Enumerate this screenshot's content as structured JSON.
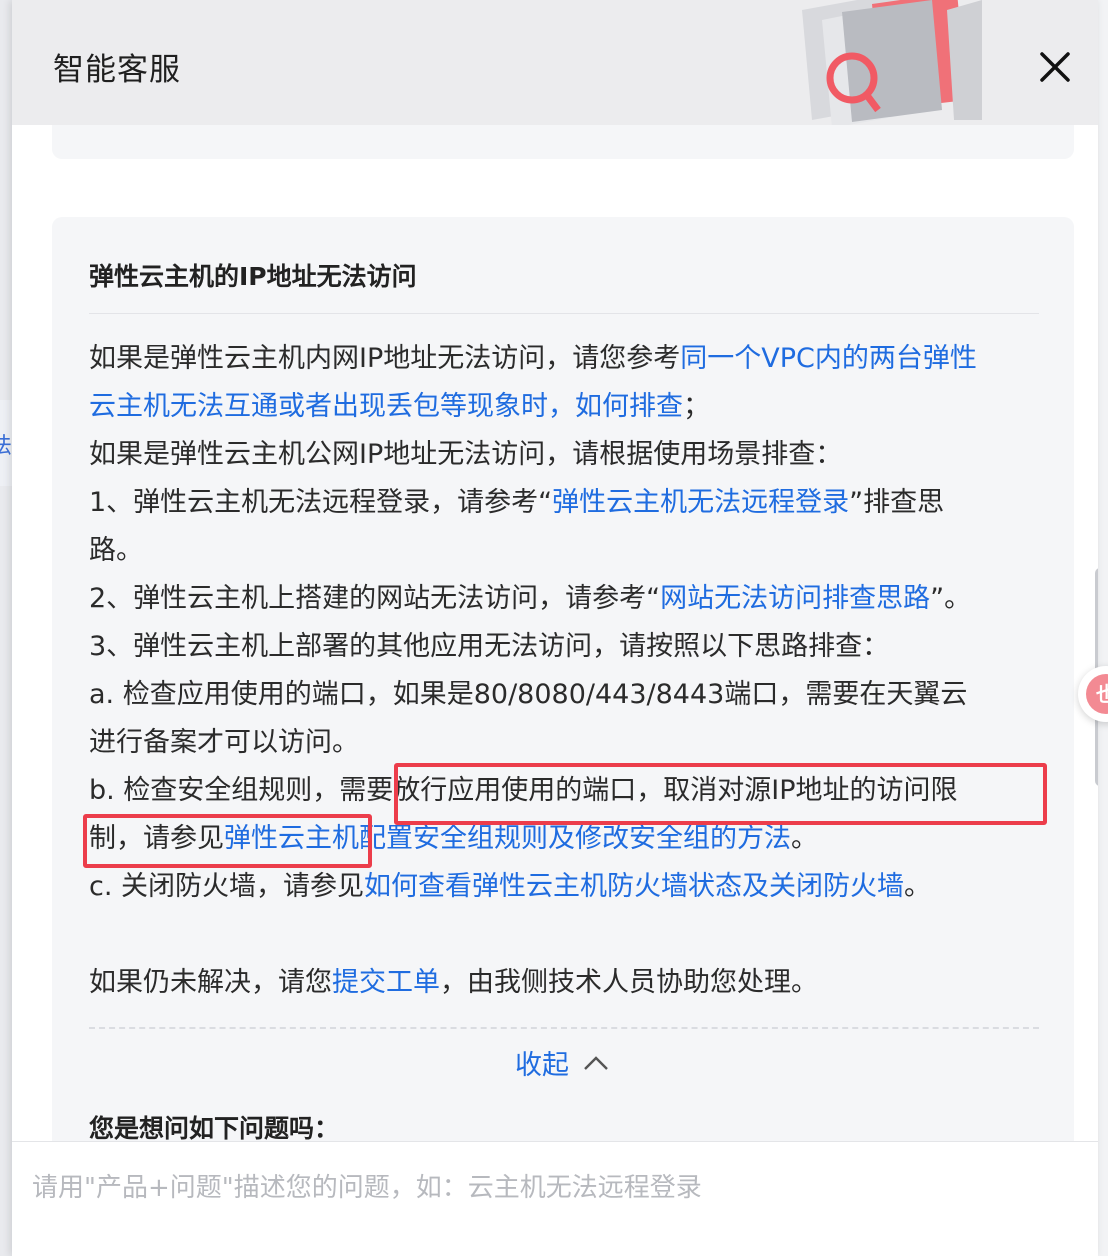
{
  "background": {
    "left_tab_char": "法",
    "float_button_char": "也"
  },
  "header": {
    "title": "智能客服",
    "close_icon": "close-icon"
  },
  "answer": {
    "title": "弹性云主机的IP地址无法访问",
    "lines": [
      [
        {
          "t": "如果是弹性云主机内网IP地址无法访问，请您参考"
        },
        {
          "t": "同一个VPC内的两台弹性",
          "link": true
        }
      ],
      [
        {
          "t": "云主机无法互通或者出现丢包等现象时，如何排查",
          "link": true
        },
        {
          "t": "；"
        }
      ],
      [
        {
          "t": "如果是弹性云主机公网IP地址无法访问，请根据使用场景排查："
        }
      ],
      [
        {
          "t": "1、弹性云主机无法远程登录，请参考“"
        },
        {
          "t": "弹性云主机无法远程登录",
          "link": true
        },
        {
          "t": "”排查思"
        }
      ],
      [
        {
          "t": "路。"
        }
      ],
      [
        {
          "t": "2、弹性云主机上搭建的网站无法访问，请参考“"
        },
        {
          "t": "网站无法访问排查思路",
          "link": true
        },
        {
          "t": "”。"
        }
      ],
      [
        {
          "t": "3、弹性云主机上部署的其他应用无法访问，请按照以下思路排查："
        }
      ],
      [
        {
          "t": "a. 检查应用使用的端口，如果是80/8080/443/8443端口，需要在天翼云"
        }
      ],
      [
        {
          "t": "进行备案才可以访问。"
        }
      ],
      [
        {
          "t": "b. 检查安全组规则，需要放行应用使用的端口，取消对源IP地址的访问限"
        }
      ],
      [
        {
          "t": "制，请参见"
        },
        {
          "t": "弹性云主机配置安全组规则及修改安全组的方法",
          "link": true
        },
        {
          "t": "。"
        }
      ],
      [
        {
          "t": "c. 关闭防火墙，请参见"
        },
        {
          "t": "如何查看弹性云主机防火墙状态及关闭防火墙",
          "link": true
        },
        {
          "t": "。"
        }
      ],
      [
        {
          "t": ""
        }
      ],
      [
        {
          "t": "如果仍未解决，请您"
        },
        {
          "t": "提交工单",
          "link": true
        },
        {
          "t": "，由我侧技术人员协助您处理。"
        }
      ]
    ],
    "collapse_label": "收起",
    "collapse_icon": "chevron-up-icon",
    "related_title": "您是想问如下问题吗："
  },
  "input": {
    "placeholder": "请用\"产品+问题\"描述您的问题，如：云主机无法远程登录"
  },
  "colors": {
    "link": "#1f6ce0",
    "highlight_border": "#ec3d4b",
    "card_bg": "#f5f6f8"
  }
}
